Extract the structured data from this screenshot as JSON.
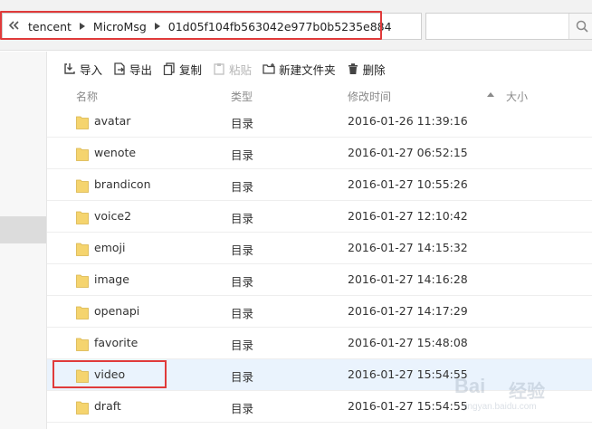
{
  "address_bar": {
    "breadcrumbs": [
      "tencent",
      "MicroMsg",
      "01d05f104fb563042e977b0b5235e884"
    ]
  },
  "toolbar": {
    "import_label": "导入",
    "export_label": "导出",
    "copy_label": "复制",
    "paste_label": "粘贴",
    "new_folder_label": "新建文件夹",
    "delete_label": "删除"
  },
  "columns": {
    "name": "名称",
    "type": "类型",
    "modified": "修改时间",
    "size": "大小"
  },
  "files": [
    {
      "name": "avatar",
      "type": "目录",
      "modified": "2016-01-26 11:39:16"
    },
    {
      "name": "wenote",
      "type": "目录",
      "modified": "2016-01-27 06:52:15"
    },
    {
      "name": "brandicon",
      "type": "目录",
      "modified": "2016-01-27 10:55:26"
    },
    {
      "name": "voice2",
      "type": "目录",
      "modified": "2016-01-27 12:10:42"
    },
    {
      "name": "emoji",
      "type": "目录",
      "modified": "2016-01-27 14:15:32"
    },
    {
      "name": "image",
      "type": "目录",
      "modified": "2016-01-27 14:16:28"
    },
    {
      "name": "openapi",
      "type": "目录",
      "modified": "2016-01-27 14:17:29"
    },
    {
      "name": "favorite",
      "type": "目录",
      "modified": "2016-01-27 15:48:08"
    },
    {
      "name": "video",
      "type": "目录",
      "modified": "2016-01-27 15:54:55"
    },
    {
      "name": "draft",
      "type": "目录",
      "modified": "2016-01-27 15:54:55"
    }
  ],
  "selected_file": "video",
  "watermark": {
    "brand": "Bai",
    "brand_cn": "经验",
    "url": "jingyan.baidu.com"
  },
  "colors": {
    "highlight_red": "#e03a3a",
    "folder_yellow": "#f5d46e",
    "selected_row": "#eaf3fd"
  },
  "icons": {
    "back": "double-chevron-left-icon",
    "search": "search-icon",
    "folder": "folder-icon"
  }
}
